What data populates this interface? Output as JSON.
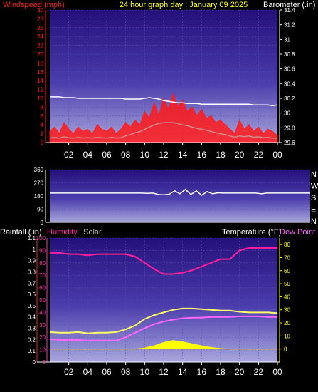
{
  "colors": {
    "windspeed": "#ff1a1a",
    "wind_avg": "#d08a8a",
    "barometer": "#ffffff",
    "direction": "#ffffff",
    "humidity": "#ff1f9f",
    "solar": "#ffff00",
    "temperature": "#ffff66",
    "dewpoint": "#ff66ff",
    "rain_axis": "#ff2020",
    "yellow_axis": "#ffff00",
    "humidity_axis": "#ff33aa"
  },
  "header": {
    "windspeed_label": "Windspeed (mph)",
    "title": "24 hour graph day : January 09 2025",
    "barometer_label": "Barometer (.in)"
  },
  "section3_header": {
    "rainfall_label": "Rainfall (.in)",
    "humidity_label": "Humidity",
    "solar_label": "Solar",
    "temperature_label": "Temperature (°F)",
    "dewpoint_label": "Dew Point (°F)"
  },
  "x_ticks": [
    "02",
    "04",
    "06",
    "08",
    "10",
    "12",
    "14",
    "16",
    "18",
    "20",
    "22",
    "00"
  ],
  "chart_data": [
    {
      "type": "line",
      "title": "24 hour graph day : January 09 2025",
      "left_axis": {
        "label": "Windspeed (mph)",
        "ticks": [
          "30",
          "28",
          "26",
          "24",
          "22",
          "20",
          "18",
          "16",
          "14",
          "12",
          "10",
          "8",
          "6",
          "4",
          "2",
          "0"
        ],
        "ylim": [
          0,
          30
        ]
      },
      "right_axis": {
        "label": "Barometer (.in)",
        "ticks": [
          "31.4",
          "31.2",
          "31",
          "30.8",
          "30.6",
          "30.4",
          "30.2",
          "30",
          "29.8",
          "29.6"
        ],
        "ylim": [
          29.6,
          31.4
        ]
      },
      "x": [
        0.0,
        0.5,
        1.0,
        1.5,
        2.0,
        2.5,
        3.0,
        3.5,
        4.0,
        4.5,
        5.0,
        5.5,
        6.0,
        6.5,
        7.0,
        7.5,
        8.0,
        8.5,
        9.0,
        9.5,
        10.0,
        10.5,
        11.0,
        11.5,
        12.0,
        12.5,
        13.0,
        13.5,
        14.0,
        14.5,
        15.0,
        15.5,
        16.0,
        16.5,
        17.0,
        17.5,
        18.0,
        18.5,
        19.0,
        19.5,
        20.0,
        20.5,
        21.0,
        21.5,
        22.0,
        22.5,
        23.0,
        23.5,
        24.0
      ],
      "series": [
        {
          "name": "Windspeed",
          "values": [
            2.5,
            3.5,
            2.0,
            4.5,
            3.0,
            2.0,
            3.5,
            2.5,
            3.0,
            2.0,
            4.0,
            3.0,
            2.5,
            3.5,
            2.0,
            3.0,
            4.5,
            3.5,
            5.0,
            4.0,
            7.0,
            5.5,
            9.0,
            6.0,
            10.0,
            7.5,
            11.0,
            8.0,
            9.5,
            7.0,
            8.0,
            6.0,
            7.5,
            5.5,
            6.0,
            4.5,
            5.0,
            4.0,
            3.0,
            2.0,
            5.0,
            3.0,
            4.0,
            2.5,
            3.5,
            2.0,
            3.0,
            2.5,
            1.5
          ]
        },
        {
          "name": "Average windspeed",
          "values": [
            1.0,
            1.2,
            1.0,
            1.3,
            1.1,
            1.0,
            1.2,
            1.0,
            1.1,
            1.0,
            1.2,
            1.1,
            1.0,
            1.2,
            1.0,
            1.1,
            1.5,
            1.8,
            2.2,
            2.5,
            3.0,
            3.5,
            4.0,
            4.3,
            4.5,
            4.5,
            4.5,
            4.3,
            4.0,
            3.8,
            3.5,
            3.2,
            3.0,
            2.8,
            2.5,
            2.2,
            2.0,
            1.8,
            1.5,
            1.2,
            1.5,
            1.3,
            1.5,
            1.2,
            1.3,
            1.1,
            1.2,
            1.0,
            1.0
          ]
        },
        {
          "name": "Barometer",
          "axis": "right",
          "values": [
            30.22,
            30.22,
            30.22,
            30.21,
            30.21,
            30.21,
            30.2,
            30.2,
            30.2,
            30.2,
            30.2,
            30.2,
            30.2,
            30.2,
            30.2,
            30.2,
            30.19,
            30.19,
            30.19,
            30.19,
            30.2,
            30.21,
            30.2,
            30.19,
            30.17,
            30.16,
            30.15,
            30.14,
            30.14,
            30.13,
            30.13,
            30.13,
            30.12,
            30.12,
            30.12,
            30.12,
            30.12,
            30.12,
            30.12,
            30.12,
            30.12,
            30.12,
            30.12,
            30.11,
            30.11,
            30.11,
            30.11,
            30.1,
            30.11
          ]
        }
      ]
    },
    {
      "type": "line",
      "left_axis": {
        "ticks": [
          "360",
          "270",
          "180",
          "90",
          "0"
        ],
        "ylim": [
          0,
          360
        ]
      },
      "right_axis": {
        "ticks": [
          "N",
          "W",
          "S",
          "E",
          "N"
        ]
      },
      "x": [
        0,
        8,
        8.5,
        9,
        9.5,
        10,
        10.5,
        11,
        11.5,
        12,
        12.5,
        13,
        13.5,
        14,
        14.5,
        15,
        15.5,
        16,
        19,
        19.5,
        20,
        24
      ],
      "series": [
        {
          "name": "Wind direction",
          "values": [
            200,
            200,
            200,
            198,
            200,
            190,
            188,
            192,
            215,
            195,
            225,
            190,
            215,
            185,
            210,
            195,
            202,
            200,
            200,
            195,
            200,
            200
          ]
        }
      ]
    },
    {
      "type": "line",
      "left_axis_outer": {
        "label": "Rainfall (.in)",
        "ticks": [
          "1.1",
          "1",
          "0.9",
          "0.8",
          "0.7",
          "0.6",
          "0.5",
          "0.4",
          "0.3",
          "0.2",
          "0.1",
          "0"
        ],
        "ylim": [
          0,
          1.1
        ]
      },
      "left_axis_inner": {
        "label": "Humidity",
        "ticks": [
          "100",
          "90",
          "80",
          "70",
          "60",
          "50",
          "40",
          "30",
          "20",
          "10",
          "0"
        ],
        "ylim": [
          0,
          100
        ]
      },
      "right_axis": {
        "label": "Temperature (°F)",
        "ticks": [
          "80",
          "70",
          "60",
          "50",
          "40",
          "30",
          "20",
          "10",
          "0"
        ],
        "ylim": [
          -10,
          85
        ]
      },
      "x": [
        0,
        1,
        2,
        3,
        4,
        5,
        6,
        7,
        8,
        9,
        10,
        11,
        12,
        13,
        14,
        15,
        16,
        17,
        18,
        19,
        20,
        21,
        22,
        23,
        24
      ],
      "series": [
        {
          "name": "Humidity",
          "axis": "humidity",
          "values": [
            88,
            88,
            87,
            87,
            86,
            87,
            87,
            87,
            87,
            85,
            80,
            75,
            71,
            71,
            72,
            74,
            77,
            80,
            83,
            83,
            90,
            92,
            92,
            92,
            92
          ]
        },
        {
          "name": "Temperature",
          "axis": "right",
          "values": [
            13,
            12.5,
            12.5,
            13,
            12,
            12.5,
            12.5,
            13,
            15,
            18,
            23,
            26,
            28,
            30,
            31,
            31,
            30.5,
            30,
            29.5,
            29.5,
            28.5,
            28,
            28,
            28,
            27.5
          ]
        },
        {
          "name": "Dew Point",
          "axis": "right",
          "values": [
            7.5,
            7,
            7,
            7,
            6.5,
            6.5,
            6.5,
            6.5,
            9,
            12.5,
            16,
            19,
            21,
            22.5,
            23.5,
            24,
            24,
            24.5,
            24.5,
            24.5,
            25,
            25,
            25,
            24.5,
            24.5
          ]
        },
        {
          "name": "Solar",
          "axis": "right",
          "values": [
            0,
            0,
            0,
            0,
            0,
            0,
            0,
            0,
            0,
            0,
            0.8,
            2.5,
            5,
            6.5,
            5.5,
            4,
            2.5,
            1.2,
            0.4,
            0,
            0,
            0,
            0,
            0,
            0
          ]
        }
      ]
    }
  ]
}
